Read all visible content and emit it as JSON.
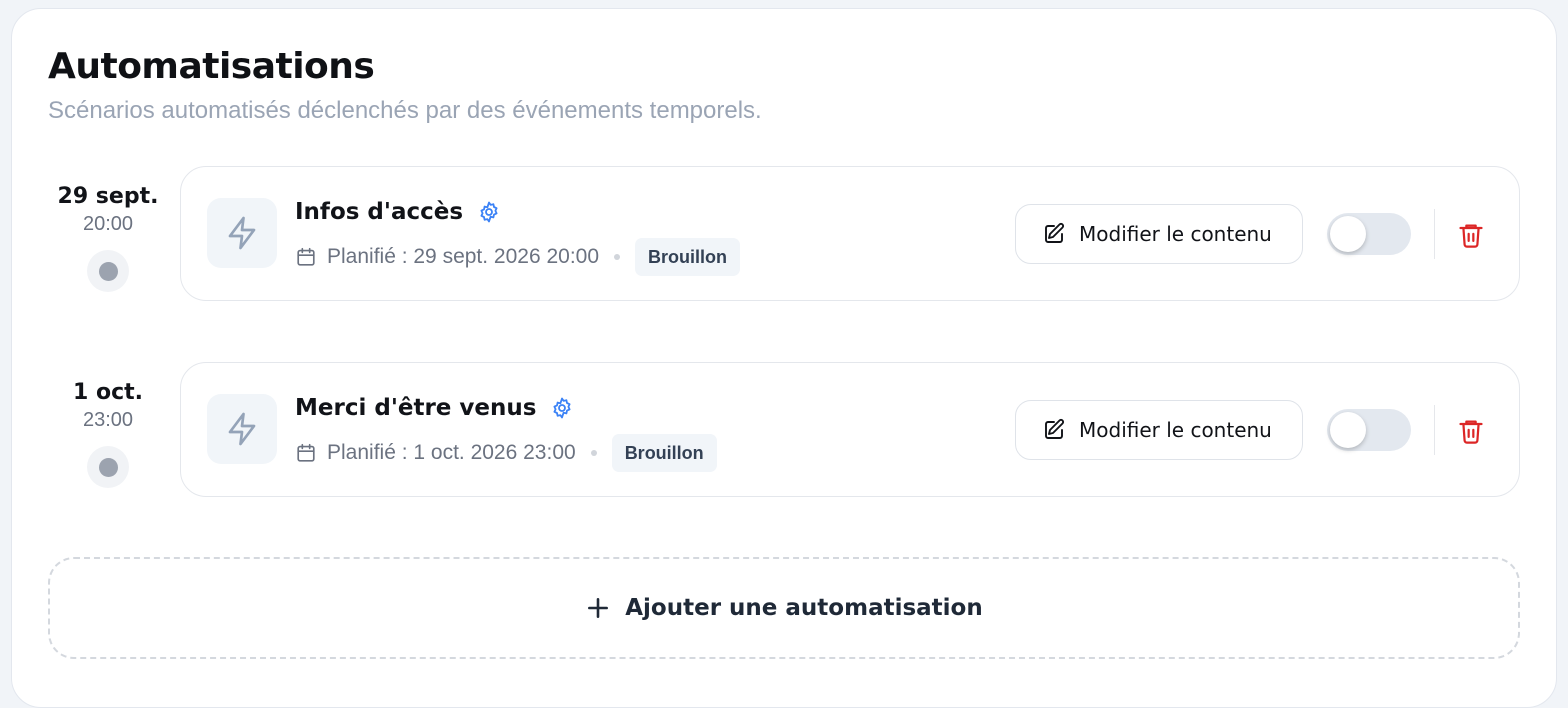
{
  "page": {
    "title": "Automatisations",
    "subtitle": "Scénarios automatisés déclenchés par des événements temporels."
  },
  "automations": [
    {
      "date_day": "29 sept.",
      "date_time": "20:00",
      "title": "Infos d'accès",
      "scheduled": "Planifié : 29 sept. 2026 20:00",
      "status": "Brouillon",
      "edit_label": "Modifier le contenu",
      "enabled": false
    },
    {
      "date_day": "1 oct.",
      "date_time": "23:00",
      "title": "Merci d'être venus",
      "scheduled": "Planifié : 1 oct. 2026 23:00",
      "status": "Brouillon",
      "edit_label": "Modifier le contenu",
      "enabled": false
    }
  ],
  "add_button": {
    "label": "Ajouter une automatisation"
  },
  "icons": {
    "automation": "lightning-bolt-icon",
    "settings": "gear-icon",
    "schedule": "calendar-icon",
    "edit": "pencil-square-icon",
    "delete": "trash-icon",
    "add": "plus-icon"
  },
  "colors": {
    "accent": "#3b82f6",
    "danger": "#dc2626",
    "muted": "#9aa4b4"
  }
}
